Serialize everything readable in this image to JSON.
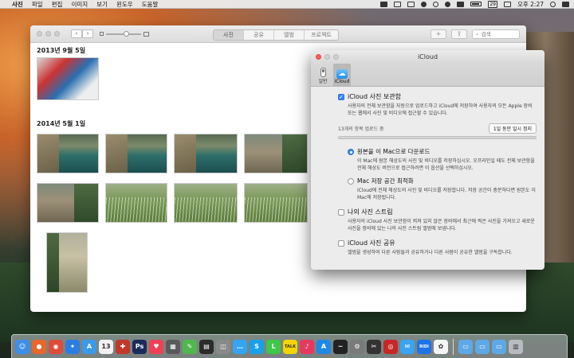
{
  "menubar": {
    "apple_icon": "apple-icon",
    "items": [
      "사진",
      "파일",
      "편집",
      "이미지",
      "보기",
      "윈도우",
      "도움말"
    ],
    "date_badge": "29",
    "clock": "오후 2:27"
  },
  "photos": {
    "segments": [
      "사진",
      "공유",
      "앨범",
      "프로젝트"
    ],
    "active_segment": 0,
    "add_label": "+",
    "share_label": "⇪",
    "search_placeholder": "검색",
    "date_groups": [
      "2013년 9월 5일",
      "2014년 5월 1일"
    ]
  },
  "icloud_panel": {
    "title": "iCloud",
    "tabs": [
      {
        "label": "일반",
        "icon": "switch-icon"
      },
      {
        "label": "iCloud",
        "icon": "cloud-icon"
      }
    ],
    "active_tab": 1,
    "library": {
      "label": "iCloud 사진 보관함",
      "checked": true,
      "description": "사용자의 전체 보관함을 자동으로 업로드하고 iCloud에 저장하여 사용자의 모든 Apple 장비 또는 웹에서 사진 및 비디오에 접근할 수 있습니다.",
      "upload_status": "13개의 항목 업로드 중",
      "pause_button": "1일 동안 일시 정지",
      "progress": 0.02
    },
    "download_option": {
      "label": "원본을 이 Mac으로 다운로드",
      "selected": true,
      "description": "이 Mac에 원본 해상도의 사진 및 비디오를 저장하십시오. 오프라인일 때도 전체 보관함을 전체 해상도 버전으로 접근하려면 이 옵션을 선택하십시오."
    },
    "optimize_option": {
      "label": "Mac 저장 공간 최적화",
      "selected": false,
      "description": "iCloud에 전체 해상도의 사진 및 비디오를 저장합니다. 저장 공간이 충분하다면 원본도 이 Mac에 저장됩니다."
    },
    "photo_stream": {
      "label": "나의 사진 스트림",
      "checked": false,
      "description": "사용자의 iCloud 사진 보관함이 켜져 있지 않은 장비에서 최근에 찍은 사진을 가져오고 새로운 사진을 장비에 있는 나의 사진 스트림 앨범에 보냅니다."
    },
    "photo_sharing": {
      "label": "iCloud 사진 공유",
      "checked": false,
      "description": "앨범을 생성하여 다른 사람들과 공유하거나 다른 사람이 공유한 앨범을 구독합니다."
    }
  },
  "dock": {
    "icons": [
      {
        "name": "finder-icon",
        "color": "#3d8ee8",
        "glyph": "☺"
      },
      {
        "name": "firefox-icon",
        "color": "#e8672a",
        "glyph": "●"
      },
      {
        "name": "chrome-icon",
        "color": "#dd4b39",
        "glyph": "◉"
      },
      {
        "name": "safari-icon",
        "color": "#2a7de1",
        "glyph": "✦"
      },
      {
        "name": "app-store-icon",
        "color": "#3a9be8",
        "glyph": "A"
      },
      {
        "name": "calendar-icon",
        "color": "#f2f2f2",
        "glyph": "13"
      },
      {
        "name": "toolbox-icon",
        "color": "#c0392b",
        "glyph": "✚"
      },
      {
        "name": "photoshop-icon",
        "color": "#1c2b5a",
        "glyph": "Ps"
      },
      {
        "name": "pocket-icon",
        "color": "#ef4056",
        "glyph": "♥"
      },
      {
        "name": "kakaotalk-icon",
        "color": "#5a5a5a",
        "glyph": "▦"
      },
      {
        "name": "evernote-icon",
        "color": "#4fb84d",
        "glyph": "✎"
      },
      {
        "name": "notes-icon",
        "color": "#2b2b2b",
        "glyph": "▤"
      },
      {
        "name": "preview-icon",
        "color": "#8a8a8a",
        "glyph": "◫"
      },
      {
        "name": "messages-icon",
        "color": "#35a4f5",
        "glyph": "…"
      },
      {
        "name": "skype-icon",
        "color": "#1aa0e8",
        "glyph": "S"
      },
      {
        "name": "line-icon",
        "color": "#3fc74a",
        "glyph": "L"
      },
      {
        "name": "talk-icon",
        "color": "#f5d400",
        "glyph": "TALK"
      },
      {
        "name": "itunes-icon",
        "color": "#e8385e",
        "glyph": "♪"
      },
      {
        "name": "appstore-icon",
        "color": "#1e88e5",
        "glyph": "A"
      },
      {
        "name": "activity-icon",
        "color": "#222222",
        "glyph": "~"
      },
      {
        "name": "system-prefs-icon",
        "color": "#7a7a7a",
        "glyph": "⚙"
      },
      {
        "name": "final-cut-icon",
        "color": "#333333",
        "glyph": "✂"
      },
      {
        "name": "photo-booth-icon",
        "color": "#c62828",
        "glyph": "◎"
      },
      {
        "name": "airmail-icon",
        "color": "#3aa3f2",
        "glyph": "✉"
      },
      {
        "name": "ridi-icon",
        "color": "#1e73e8",
        "glyph": "RIDI"
      },
      {
        "name": "photos-icon",
        "color": "#f5f5f5",
        "glyph": "✿"
      },
      {
        "name": "folder-apps-icon",
        "color": "#5fa8e6",
        "glyph": "▭"
      },
      {
        "name": "folder-docs-icon",
        "color": "#5fa8e6",
        "glyph": "▭"
      },
      {
        "name": "folder-downloads-icon",
        "color": "#5fa8e6",
        "glyph": "▭"
      },
      {
        "name": "trash-icon",
        "color": "#b8bcc0",
        "glyph": "▥"
      }
    ]
  }
}
